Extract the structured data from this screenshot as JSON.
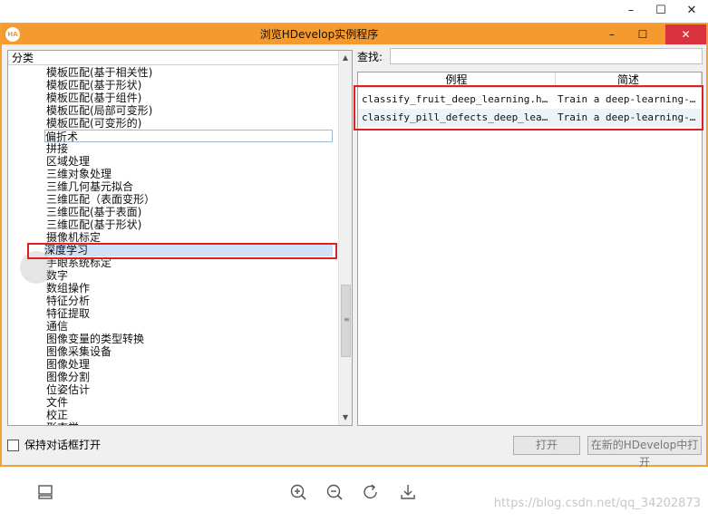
{
  "window": {
    "app_icon_text": "HA",
    "title": "浏览HDevelop实例程序",
    "minimize": "–",
    "maximize": "☐",
    "close": "✕"
  },
  "outer_chrome": {
    "minimize": "–",
    "maximize": "☐",
    "close": "✕"
  },
  "left_pane": {
    "header": "分类",
    "items": [
      "模板匹配(基于相关性)",
      "模板匹配(基于形状)",
      "模板匹配(基于组件)",
      "模板匹配(局部可变形)",
      "模板匹配(可变形的)",
      "偏折术",
      "拼接",
      "区域处理",
      "三维对象处理",
      "三维几何基元拟合",
      "三维匹配（表面变形）",
      "三维匹配(基于表面)",
      "三维匹配(基于形状)",
      "摄像机标定",
      "深度学习",
      "手眼系统标定",
      "数字",
      "数组操作",
      "特征分析",
      "特征提取",
      "通信",
      "图像变量的类型转换",
      "图像采集设备",
      "图像处理",
      "图像分割",
      "位姿估计",
      "文件",
      "校正",
      "形态学"
    ]
  },
  "search": {
    "label": "查找:",
    "value": ""
  },
  "right_pane": {
    "columns": [
      "例程",
      "简述"
    ],
    "rows": [
      {
        "name": "classify_fruit_deep_learning.hdev",
        "desc": "Train a deep-learning-b…"
      },
      {
        "name": "classify_pill_defects_deep_learni…",
        "desc": "Train a deep-learning-b…"
      }
    ]
  },
  "bottom": {
    "keep_open_label": "保持对话框打开",
    "open_label": "打开",
    "open_new_label": "在新的HDevelop中打开"
  },
  "watermark": "https://blog.csdn.net/qq_34202873"
}
